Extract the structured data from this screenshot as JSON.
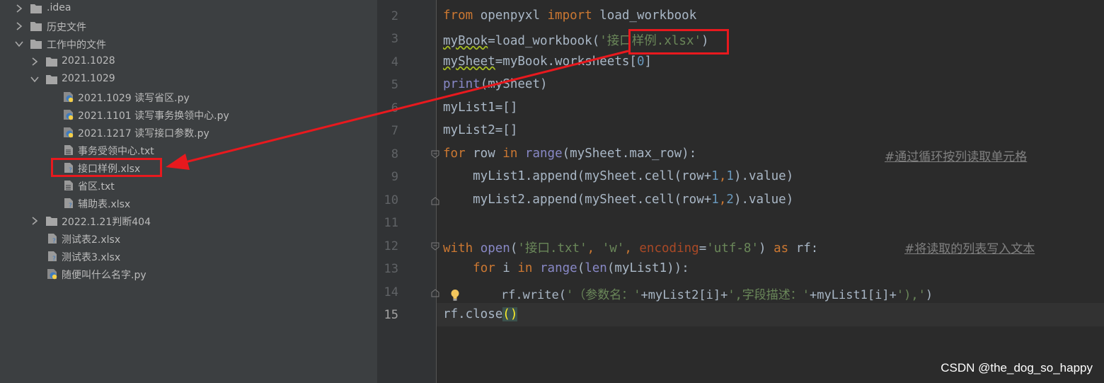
{
  "tree": {
    "items": [
      {
        "label": ".idea"
      },
      {
        "label": "历史文件"
      },
      {
        "label": "工作中的文件"
      },
      {
        "label": "2021.1028"
      },
      {
        "label": "2021.1029"
      },
      {
        "label": "2021.1029 读写省区.py"
      },
      {
        "label": "2021.1101 读写事务换领中心.py"
      },
      {
        "label": "2021.1217 读写接口参数.py"
      },
      {
        "label": "事务受领中心.txt"
      },
      {
        "label": "接口样例.xlsx"
      },
      {
        "label": "省区.txt"
      },
      {
        "label": "辅助表.xlsx"
      },
      {
        "label": "2022.1.21判断404"
      },
      {
        "label": "测试表2.xlsx"
      },
      {
        "label": "测试表3.xlsx"
      },
      {
        "label": "随便叫什么名字.py"
      }
    ]
  },
  "editor": {
    "line_numbers": [
      "2",
      "3",
      "4",
      "5",
      "6",
      "7",
      "8",
      "9",
      "10",
      "11",
      "12",
      "13",
      "14",
      "15"
    ],
    "current_line": "15",
    "tokens": {
      "l2": [
        "from",
        " openpyxl ",
        "import",
        " load_workbook"
      ],
      "l3": [
        "myBook",
        "=load_workbook(",
        "'接口样例.xlsx'",
        ")"
      ],
      "l4": [
        "mySheet",
        "=myBook.worksheets[",
        "0",
        "]"
      ],
      "l5": [
        "print",
        "(mySheet)"
      ],
      "l6": [
        "myList1",
        "=[]"
      ],
      "l7": [
        "myList2",
        "=[]"
      ],
      "l8": [
        "for",
        " row ",
        "in",
        " ",
        "range",
        "(mySheet.max_row):",
        "#通过循环按列读取单元格"
      ],
      "l9": [
        "    myList1.append(mySheet.cell(row+",
        "1",
        ",",
        "1",
        ").value)"
      ],
      "l10": [
        "    myList2.append(mySheet.cell(row+",
        "1",
        ",",
        "2",
        ").value)"
      ],
      "l12": [
        "with",
        " ",
        "open",
        "(",
        "'接口.txt'",
        ", ",
        "'w'",
        ", ",
        "encoding",
        "=",
        "'utf-8'",
        ") ",
        "as",
        " rf:",
        "#将读取的列表写入文本"
      ],
      "l13": [
        "    ",
        "for",
        " i ",
        "in",
        " ",
        "range",
        "(",
        "len",
        "(myList1)):"
      ],
      "l14": [
        "        rf.write(",
        "'（参数名：'",
        "+myList2[i]+",
        "',字段描述：'",
        "+myList1[i]+",
        "'),'",
        ")"
      ],
      "l15": [
        "rf.close",
        "(",
        ")"
      ]
    }
  },
  "watermark": "CSDN @the_dog_so_happy",
  "colors": {
    "annotation_red": "#e8191e",
    "keyword": "#cc7832",
    "string": "#6a8759",
    "number": "#6897bb",
    "comment": "#808080"
  }
}
